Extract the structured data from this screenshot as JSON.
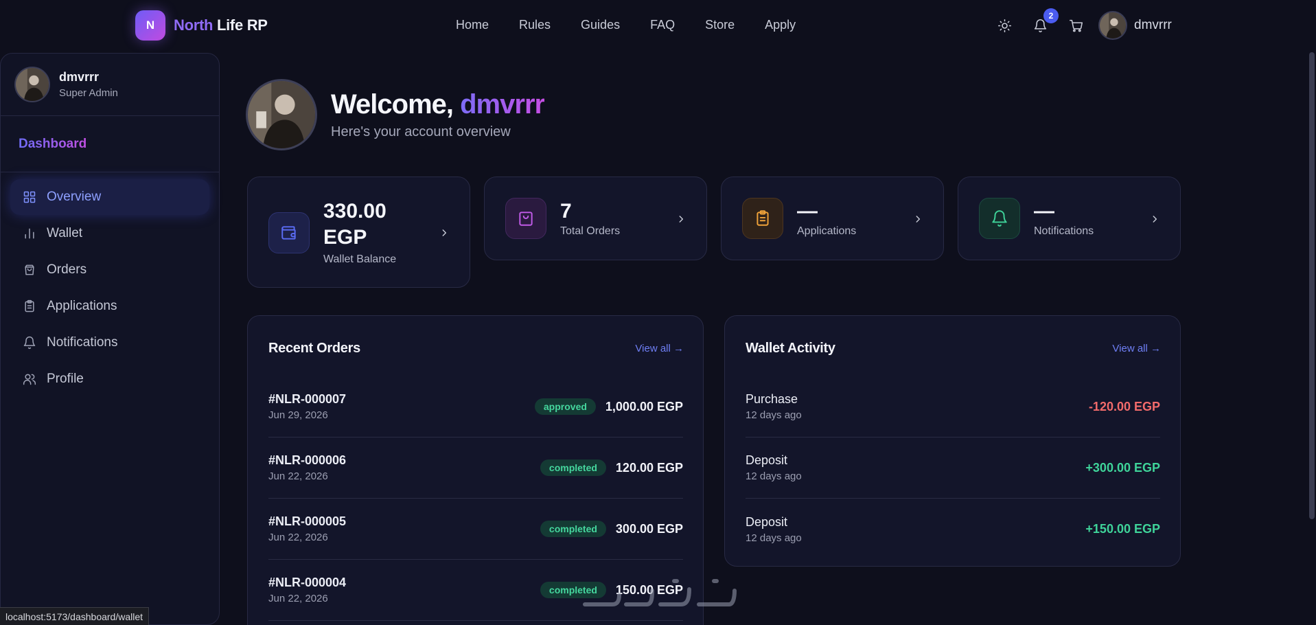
{
  "brand": {
    "logo_letter": "N",
    "name_part1": "North",
    "name_part2": "Life RP"
  },
  "nav": {
    "links": [
      "Home",
      "Rules",
      "Guides",
      "FAQ",
      "Store",
      "Apply"
    ]
  },
  "header": {
    "notification_count": "2",
    "username": "dmvrrr",
    "icons": [
      "sun-icon",
      "bell-icon",
      "cart-icon"
    ]
  },
  "sidebar": {
    "username": "dmvrrr",
    "role": "Super Admin",
    "title": "Dashboard",
    "items": [
      {
        "label": "Overview",
        "icon": "grid-icon",
        "active": true
      },
      {
        "label": "Wallet",
        "icon": "bar-chart-icon"
      },
      {
        "label": "Orders",
        "icon": "bag-icon"
      },
      {
        "label": "Applications",
        "icon": "clipboard-icon"
      },
      {
        "label": "Notifications",
        "icon": "bell-icon"
      },
      {
        "label": "Profile",
        "icon": "users-icon"
      }
    ]
  },
  "welcome": {
    "greeting": "Welcome,",
    "name": "dmvrrr",
    "subtitle": "Here's your account overview"
  },
  "stats": [
    {
      "value_line1": "330.00",
      "value_line2": "EGP",
      "label": "Wallet Balance",
      "icon": "wallet-icon",
      "color": "#5b6cf5"
    },
    {
      "value": "7",
      "label": "Total Orders",
      "icon": "bag-icon",
      "color": "#c15be8"
    },
    {
      "value": "—",
      "label": "Applications",
      "icon": "clipboard-icon",
      "color": "#f0a33a"
    },
    {
      "value": "—",
      "label": "Notifications",
      "icon": "bell-icon",
      "color": "#3fd49a"
    }
  ],
  "recent_orders": {
    "title": "Recent Orders",
    "view_all": "View all →",
    "rows": [
      {
        "id": "#NLR-000007",
        "date": "Jun 29, 2026",
        "status": "approved",
        "amount": "1,000.00 EGP"
      },
      {
        "id": "#NLR-000006",
        "date": "Jun 22, 2026",
        "status": "completed",
        "amount": "120.00 EGP"
      },
      {
        "id": "#NLR-000005",
        "date": "Jun 22, 2026",
        "status": "completed",
        "amount": "300.00 EGP"
      },
      {
        "id": "#NLR-000004",
        "date": "Jun 22, 2026",
        "status": "completed",
        "amount": "150.00 EGP"
      }
    ]
  },
  "wallet_activity": {
    "title": "Wallet Activity",
    "view_all": "View all →",
    "rows": [
      {
        "type": "Purchase",
        "time": "12 days ago",
        "amount": "-120.00 EGP",
        "color": "#f26b6b"
      },
      {
        "type": "Deposit",
        "time": "12 days ago",
        "amount": "+300.00 EGP",
        "color": "#3fd49a"
      },
      {
        "type": "Deposit",
        "time": "12 days ago",
        "amount": "+150.00 EGP",
        "color": "#3fd49a"
      }
    ]
  },
  "statusbar": {
    "url": "localhost:5173/dashboard/wallet"
  }
}
